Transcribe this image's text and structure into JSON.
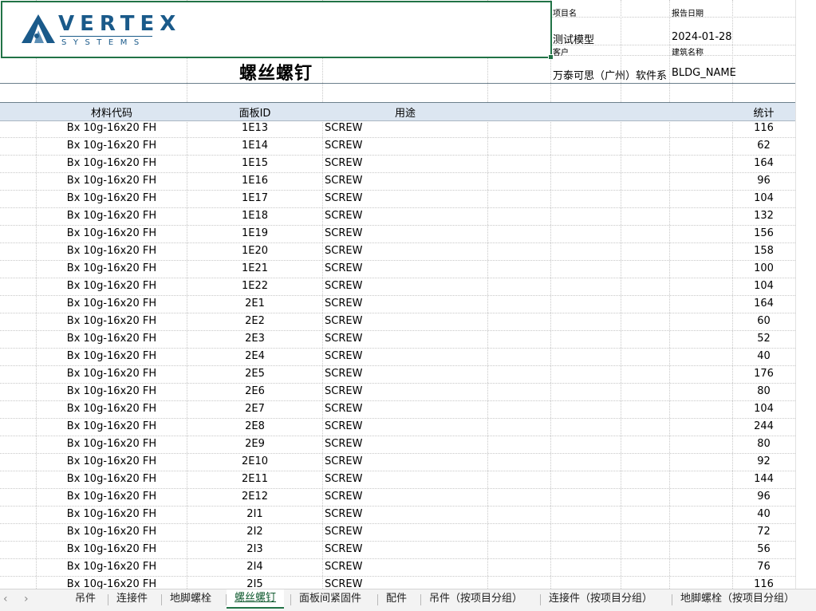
{
  "logo": {
    "word": "VERTEX",
    "sub": "SYSTEMS"
  },
  "info": {
    "project_label": "项目名",
    "date_label": "报告日期",
    "project_value": "测试模型",
    "date_value": "2024-01-28",
    "client_label": "客户",
    "building_label": "建筑名称",
    "client_value": "万泰可思（广州）软件系",
    "building_value": "BLDG_NAME"
  },
  "title": "螺丝螺钉",
  "columns": {
    "code": "材料代码",
    "panel_id": "面板ID",
    "usage": "用途",
    "count": "统计"
  },
  "rows": [
    {
      "code": "Bx 10g-16x20 FH",
      "id": "1E13",
      "use": "SCREW",
      "count": "116"
    },
    {
      "code": "Bx 10g-16x20 FH",
      "id": "1E14",
      "use": "SCREW",
      "count": "62"
    },
    {
      "code": "Bx 10g-16x20 FH",
      "id": "1E15",
      "use": "SCREW",
      "count": "164"
    },
    {
      "code": "Bx 10g-16x20 FH",
      "id": "1E16",
      "use": "SCREW",
      "count": "96"
    },
    {
      "code": "Bx 10g-16x20 FH",
      "id": "1E17",
      "use": "SCREW",
      "count": "104"
    },
    {
      "code": "Bx 10g-16x20 FH",
      "id": "1E18",
      "use": "SCREW",
      "count": "132"
    },
    {
      "code": "Bx 10g-16x20 FH",
      "id": "1E19",
      "use": "SCREW",
      "count": "156"
    },
    {
      "code": "Bx 10g-16x20 FH",
      "id": "1E20",
      "use": "SCREW",
      "count": "158"
    },
    {
      "code": "Bx 10g-16x20 FH",
      "id": "1E21",
      "use": "SCREW",
      "count": "100"
    },
    {
      "code": "Bx 10g-16x20 FH",
      "id": "1E22",
      "use": "SCREW",
      "count": "104"
    },
    {
      "code": "Bx 10g-16x20 FH",
      "id": "2E1",
      "use": "SCREW",
      "count": "164"
    },
    {
      "code": "Bx 10g-16x20 FH",
      "id": "2E2",
      "use": "SCREW",
      "count": "60"
    },
    {
      "code": "Bx 10g-16x20 FH",
      "id": "2E3",
      "use": "SCREW",
      "count": "52"
    },
    {
      "code": "Bx 10g-16x20 FH",
      "id": "2E4",
      "use": "SCREW",
      "count": "40"
    },
    {
      "code": "Bx 10g-16x20 FH",
      "id": "2E5",
      "use": "SCREW",
      "count": "176"
    },
    {
      "code": "Bx 10g-16x20 FH",
      "id": "2E6",
      "use": "SCREW",
      "count": "80"
    },
    {
      "code": "Bx 10g-16x20 FH",
      "id": "2E7",
      "use": "SCREW",
      "count": "104"
    },
    {
      "code": "Bx 10g-16x20 FH",
      "id": "2E8",
      "use": "SCREW",
      "count": "244"
    },
    {
      "code": "Bx 10g-16x20 FH",
      "id": "2E9",
      "use": "SCREW",
      "count": "80"
    },
    {
      "code": "Bx 10g-16x20 FH",
      "id": "2E10",
      "use": "SCREW",
      "count": "92"
    },
    {
      "code": "Bx 10g-16x20 FH",
      "id": "2E11",
      "use": "SCREW",
      "count": "144"
    },
    {
      "code": "Bx 10g-16x20 FH",
      "id": "2E12",
      "use": "SCREW",
      "count": "96"
    },
    {
      "code": "Bx 10g-16x20 FH",
      "id": "2I1",
      "use": "SCREW",
      "count": "40"
    },
    {
      "code": "Bx 10g-16x20 FH",
      "id": "2I2",
      "use": "SCREW",
      "count": "72"
    },
    {
      "code": "Bx 10g-16x20 FH",
      "id": "2I3",
      "use": "SCREW",
      "count": "56"
    },
    {
      "code": "Bx 10g-16x20 FH",
      "id": "2I4",
      "use": "SCREW",
      "count": "76"
    },
    {
      "code": "Bx 10g-16x20 FH",
      "id": "2I5",
      "use": "SCREW",
      "count": "116"
    }
  ],
  "tabs": [
    {
      "label": "吊件",
      "active": false
    },
    {
      "label": "连接件",
      "active": false
    },
    {
      "label": "地脚螺栓",
      "active": false
    },
    {
      "label": "螺丝螺钉",
      "active": true
    },
    {
      "label": "面板间紧固件",
      "active": false
    },
    {
      "label": "配件",
      "active": false
    },
    {
      "label": "吊件（按项目分组）",
      "active": false
    },
    {
      "label": "连接件（按项目分组）",
      "active": false
    },
    {
      "label": "地脚螺栓（按项目分组）",
      "active": false
    }
  ],
  "nav": {
    "prev": "‹",
    "next": "›"
  },
  "colors": {
    "accent": "#217346",
    "header_band": "#dce6f1",
    "logo_blue": "#1a5a8a"
  }
}
